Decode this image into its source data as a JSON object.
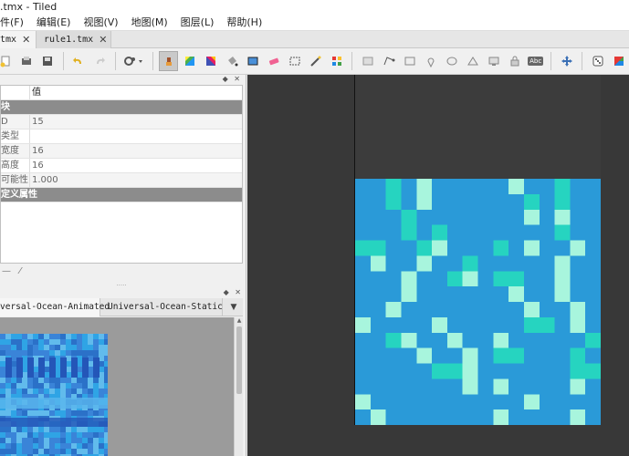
{
  "window": {
    "title": ".tmx - Tiled"
  },
  "menu": [
    "编辑(E)",
    "视图(V)",
    "地图(M)",
    "图层(L)",
    "帮助(H)"
  ],
  "menu_first": "件(F)",
  "tabs": [
    {
      "label": "tmx",
      "active": true,
      "close": "✕"
    },
    {
      "label": "rule1.tmx",
      "active": false,
      "close": "✕"
    }
  ],
  "properties": {
    "header_value": "值",
    "group_tile": "块",
    "rows": [
      {
        "key": "D",
        "value": "15"
      },
      {
        "key": "类型",
        "value": ""
      },
      {
        "key": "宽度",
        "value": "16"
      },
      {
        "key": "高度",
        "value": "16"
      },
      {
        "key": "可能性",
        "value": "1.000"
      }
    ],
    "group_custom": "定义属性"
  },
  "tileset_tabs": [
    {
      "label": "versal-Ocean-Animated",
      "active": true
    },
    {
      "label": "Universal-Ocean-Static",
      "active": false
    }
  ],
  "colors": {
    "water": "#2a9ad8",
    "foam": "#a8f5dd",
    "shallow": "#26d4c0"
  },
  "icons": {
    "new": "new-file-icon",
    "save": "save-icon",
    "undo": "undo-icon",
    "redo": "redo-icon",
    "stamp": "stamp-brush-icon",
    "bucket": "bucket-fill-icon",
    "eraser": "eraser-icon",
    "rect-select": "rect-select-icon",
    "text": "Abc"
  }
}
